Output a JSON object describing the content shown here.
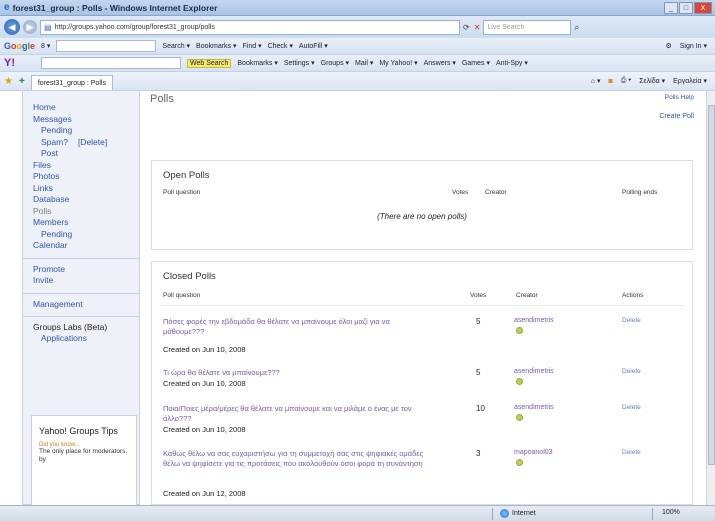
{
  "window": {
    "title": "forest31_group : Polls - Windows Internet Explorer",
    "minimize": "_",
    "maximize": "□",
    "close": "X"
  },
  "address_bar": {
    "url": "http://groups.yahoo.com/group/forest31_group/polls",
    "live_search_placeholder": "Live Search"
  },
  "google_toolbar": {
    "logo": "Google",
    "menu": "8 ▾",
    "search": "Search ▾",
    "bookmarks": "Bookmarks ▾",
    "find": "Find ▾",
    "check": "Check ▾",
    "autofill": "AutoFill ▾",
    "sign_in": "Sign In ▾"
  },
  "yahoo_toolbar": {
    "logo": "Y!",
    "web_search": "Web Search",
    "bookmarks": "Bookmarks ▾",
    "settings": "Settings ▾",
    "groups": "Groups ▾",
    "mail": "Mail ▾",
    "my_yahoo": "My Yahoo! ▾",
    "answers": "Answers ▾",
    "games": "Games ▾",
    "anti_spy": "Anti-Spy ▾"
  },
  "tab": {
    "label": "forest31_group : Polls",
    "right_page": "Σελίδα ▾",
    "right_tools": "Εργαλεία ▾"
  },
  "sidebar": {
    "items": [
      {
        "label": "Home"
      },
      {
        "label": "Messages"
      },
      {
        "label": "Pending"
      },
      {
        "label": "Spam?",
        "extra": "[Delete]"
      },
      {
        "label": "Post"
      },
      {
        "label": "Files"
      },
      {
        "label": "Photos"
      },
      {
        "label": "Links"
      },
      {
        "label": "Database"
      },
      {
        "label": "Polls"
      },
      {
        "label": "Members"
      },
      {
        "label": "Pending"
      },
      {
        "label": "Calendar"
      }
    ],
    "promote": "Promote",
    "invite": "Invite",
    "management": "Management",
    "labs_title": "Groups Labs (Beta)",
    "applications": "Applications",
    "tips_title": "Yahoo! Groups Tips",
    "tips_kicker": "Did you know...",
    "tips_text": "The only place for moderators, by"
  },
  "main": {
    "title": "Polls",
    "help": "Polls Help",
    "create": "Create Poll",
    "open": {
      "heading": "Open Polls",
      "col_question": "Poll question",
      "col_votes": "Votes",
      "col_creator": "Creator",
      "col_ends": "Polling ends",
      "empty": "(There are no open polls)"
    },
    "closed": {
      "heading": "Closed Polls",
      "col_question": "Poll question",
      "col_votes": "Votes",
      "col_creator": "Creator",
      "col_actions": "Actions",
      "rows": [
        {
          "question": "Πόσες φορές την εβδομάδα θα θέλατε να μπαίνουμε όλοι μαζί για να μάθουμε???",
          "created": "Created on Jun 10, 2008",
          "votes": "5",
          "creator": "asendimetris",
          "action": "Delete"
        },
        {
          "question": "Τι ώρα θα θέλατε να μπαίνουμε???",
          "created": "Created on Jun 10, 2008",
          "votes": "5",
          "creator": "asendimetris",
          "action": "Delete"
        },
        {
          "question": "Ποια/Ποιες μέρα/μέρες θα θέλατε να μπαίνουμε και να μιλάμε ο ένας με τον άλλο???",
          "created": "Created on Jun 10, 2008",
          "votes": "10",
          "creator": "asendimetris",
          "action": "Delete"
        },
        {
          "question": "Καθώς θέλω να σας ευχαριστήσω για τη συμμετοχή σας στις ψηφιακές ομάδες θέλω να ψηφίσετε για τις προτάσεις που ακολουθούν όσοι φορά τη συνάντηση",
          "created": "Created on Jun 12, 2008",
          "votes": "3",
          "creator": "mapoanol03",
          "action": "Delete"
        }
      ]
    }
  },
  "statusbar": {
    "zone": "Internet",
    "zoom": "100%"
  }
}
